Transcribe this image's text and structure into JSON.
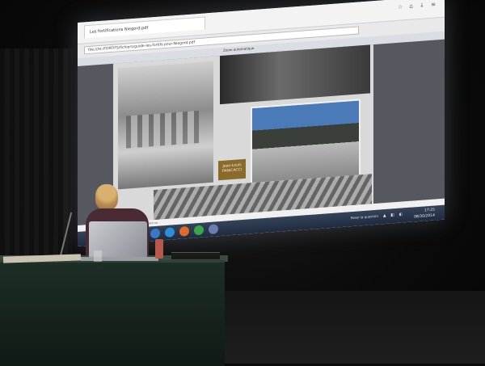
{
  "browser": {
    "tab_title": "Les fortifications Niegord.pdf",
    "url": "file:///H:/FORTIFS/fichiers/guide-les-fortifs-pour-Niegord.pdf",
    "pdf_section": "Zoom automatique"
  },
  "slide": {
    "author_box": "Jean-Louis PANICACCI"
  },
  "status_bar": {
    "text": "gallery n'ouvre de Nouveaux et par leur suivent vu"
  },
  "taskbar": {
    "search_text": "Poser la question",
    "time": "17:25",
    "date": "08/30/2014"
  },
  "colors": {
    "taskbar": "#2a3850",
    "table_cloth": "#1d2e26",
    "presenter_shirt": "#4a2a33"
  }
}
